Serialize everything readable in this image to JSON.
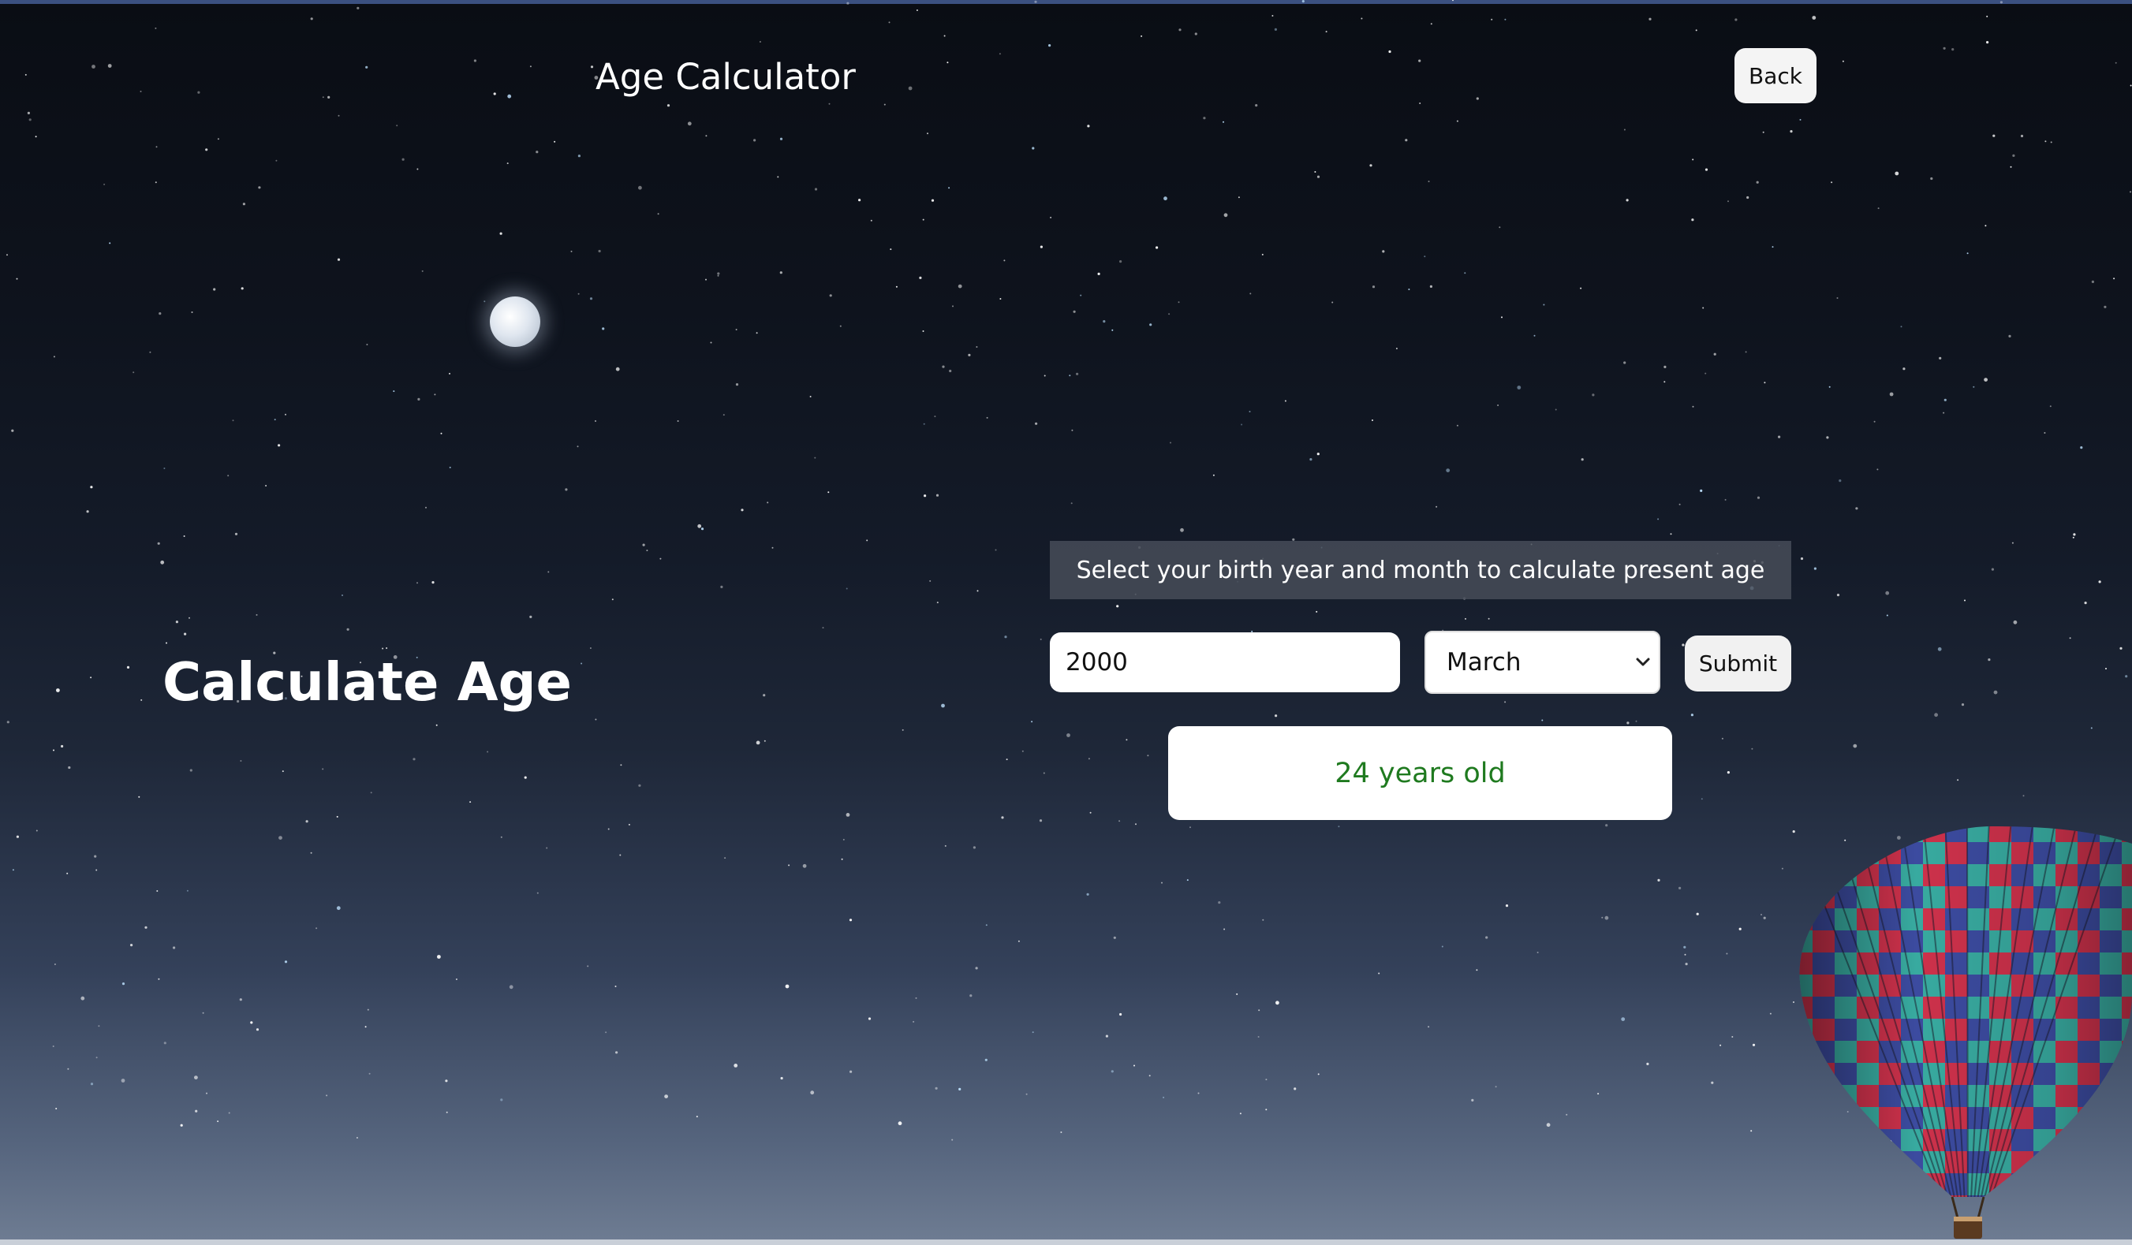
{
  "header": {
    "app_title": "Age Calculator",
    "back_label": "Back"
  },
  "hero": {
    "title": "Calculate Age"
  },
  "form": {
    "instruction": "Select your birth year and month to calculate present age",
    "year_value": "2000",
    "month_selected": "March",
    "submit_label": "Submit"
  },
  "result": {
    "text": "24 years old"
  },
  "colors": {
    "result_text": "#1f7a1f",
    "instruction_bg": "#464c58"
  },
  "icons": {
    "select_arrow": "chevron-down-icon"
  }
}
